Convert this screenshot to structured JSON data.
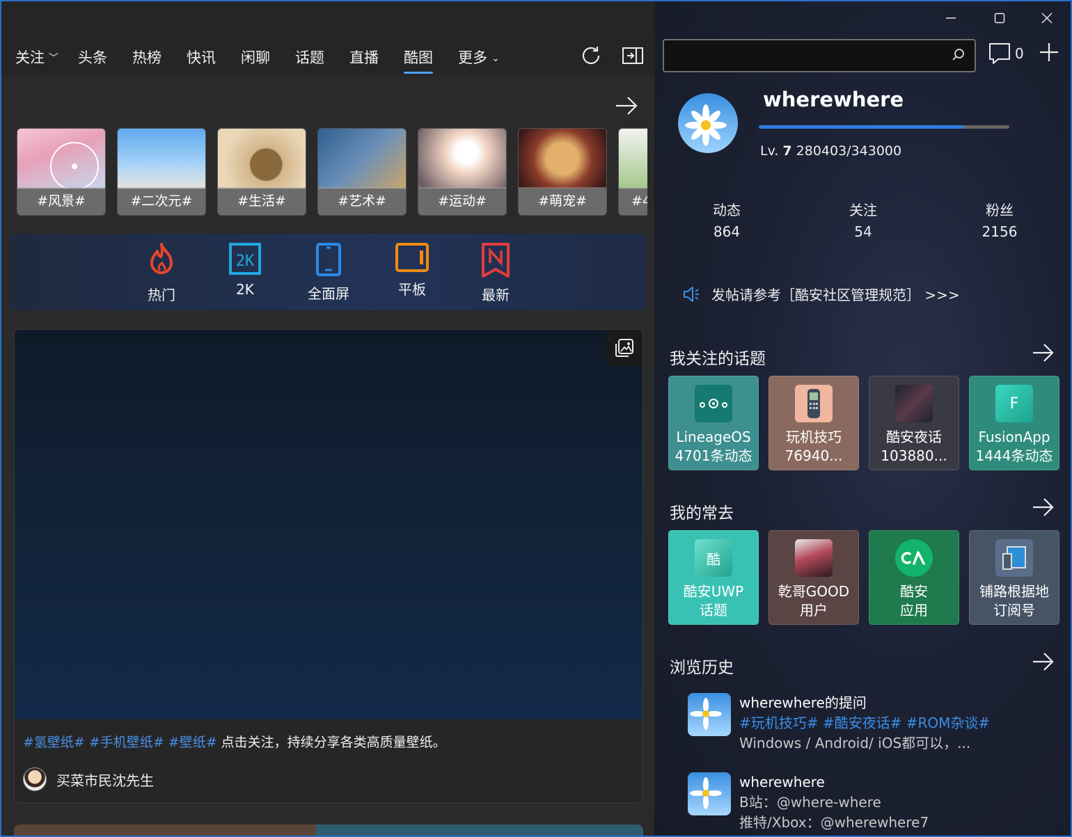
{
  "nav": {
    "items": [
      "关注",
      "头条",
      "热榜",
      "快讯",
      "闲聊",
      "话题",
      "直播",
      "酷图",
      "更多"
    ],
    "active": "酷图",
    "refresh_icon": "refresh-icon",
    "sidebar_icon": "collapse-pane-icon"
  },
  "tags": [
    {
      "label": "#风景#"
    },
    {
      "label": "#二次元#"
    },
    {
      "label": "#生活#"
    },
    {
      "label": "#艺术#"
    },
    {
      "label": "#运动#"
    },
    {
      "label": "#萌宠#"
    },
    {
      "label": "#4"
    }
  ],
  "categories": [
    {
      "label": "热门",
      "icon": "flame-icon",
      "color": "#e8452c"
    },
    {
      "label": "2K",
      "icon": "2k-icon",
      "color": "#22a7e0"
    },
    {
      "label": "全面屏",
      "icon": "phone-icon",
      "color": "#2b8be8"
    },
    {
      "label": "平板",
      "icon": "tablet-icon",
      "color": "#f08a12"
    },
    {
      "label": "最新",
      "icon": "new-icon",
      "color": "#e23c3c"
    }
  ],
  "post": {
    "hashtags": [
      "#氢壁纸#",
      "#手机壁纸#",
      "#壁纸#"
    ],
    "text": "点击关注，持续分享各类高质量壁纸。",
    "author": "买菜市民沈先生"
  },
  "window": {
    "minimize": "—",
    "maximize": "☐",
    "close": "✕"
  },
  "search": {
    "placeholder": ""
  },
  "messages": {
    "count": "0"
  },
  "profile": {
    "username": "wherewhere",
    "level_label": "Lv.",
    "level": "7",
    "xp": "280403/343000",
    "xp_fraction": 0.8175,
    "stats": [
      {
        "label": "动态",
        "value": "864"
      },
      {
        "label": "关注",
        "value": "54"
      },
      {
        "label": "粉丝",
        "value": "2156"
      }
    ]
  },
  "notice": "发帖请参考［酷安社区管理规范］ >>>",
  "followed_topics": {
    "title": "我关注的话题",
    "items": [
      {
        "line1": "LineageOS",
        "line2": "4701条动态",
        "bg": "#3e8f8f"
      },
      {
        "line1": "玩机技巧",
        "line2": "76940...",
        "bg": "#8a6a5e"
      },
      {
        "line1": "酷安夜话",
        "line2": "103880...",
        "bg": "#3a3a44"
      },
      {
        "line1": "FusionApp",
        "line2": "1444条动态",
        "bg": "#2f8c7d"
      }
    ]
  },
  "frequent": {
    "title": "我的常去",
    "items": [
      {
        "line1": "酷安UWP",
        "line2": "话题",
        "bg": "#39c2b4"
      },
      {
        "line1": "乾哥GOOD",
        "line2": "用户",
        "bg": "#5a4444"
      },
      {
        "line1": "酷安",
        "line2": "应用",
        "bg": "#1f7a4e"
      },
      {
        "line1": "铺路根据地",
        "line2": "订阅号",
        "bg": "#465466"
      }
    ]
  },
  "history": {
    "title": "浏览历史",
    "items": [
      {
        "title": "wherewhere的提问",
        "line2": "#玩机技巧# #酷安夜话# #ROM杂谈#",
        "line3": "Windows / Android/ iOS都可以，..."
      },
      {
        "title": "wherewhere",
        "line2": "B站：@where-where",
        "line3": "推特/Xbox：@wherewhere7"
      }
    ]
  }
}
